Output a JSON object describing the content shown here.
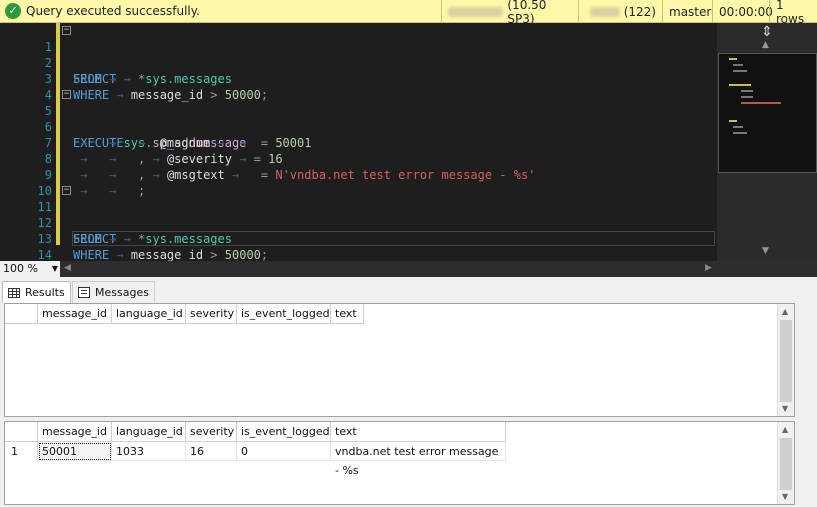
{
  "status": {
    "message": "Query executed successfully.",
    "version": "(10.50 SP3)",
    "spid": "(122)",
    "database": "master",
    "elapsed": "00:00:00",
    "rows": "1 rows"
  },
  "editor": {
    "lines": [
      {
        "n": "1"
      },
      {
        "n": "2"
      },
      {
        "n": "3"
      },
      {
        "n": "4"
      },
      {
        "n": "5"
      },
      {
        "n": "6"
      },
      {
        "n": "7"
      },
      {
        "n": "8"
      },
      {
        "n": "9"
      },
      {
        "n": "10"
      },
      {
        "n": "11"
      },
      {
        "n": "12"
      },
      {
        "n": "13"
      },
      {
        "n": "14"
      }
    ],
    "tokens": {
      "select": "SELECT",
      "star": "*",
      "from": "FROM",
      "sys_messages": "sys.messages",
      "where": "WHERE",
      "message_id": "message_id",
      "gt": ">",
      "fifty_k": "50000",
      "semi": ";",
      "execute": "EXECUTE",
      "sys_prefix": "sys.",
      "sp_name": "sp_addmessage",
      "msgnum": "@msgnum",
      "eq": "=",
      "msgnum_val": "50001",
      "comma": ",",
      "severity": "@severity",
      "severity_val": "16",
      "msgtext": "@msgtext",
      "msgtext_val": "N'vndba.net test error message - %s'"
    }
  },
  "zoom": "100 %",
  "tabs": {
    "results": "Results",
    "messages": "Messages"
  },
  "grid": {
    "columns": [
      "message_id",
      "language_id",
      "severity",
      "is_event_logged",
      "text"
    ],
    "rows": [
      {
        "num": "1",
        "cells": [
          "50001",
          "1033",
          "16",
          "0",
          "vndba.net test error message - %s"
        ]
      }
    ]
  }
}
